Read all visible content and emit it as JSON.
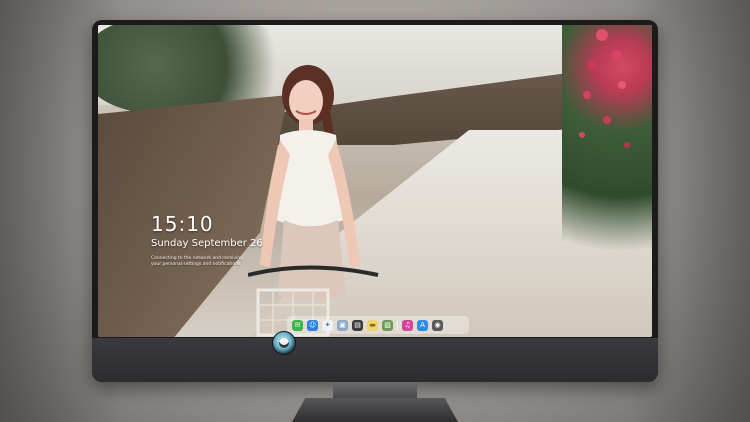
{
  "lock_screen": {
    "time": "15:10",
    "date": "Sunday September 26",
    "note_lines": [
      "Connecting to the network and receiving",
      "your personal settings and notifications"
    ]
  },
  "dock": {
    "items": [
      {
        "name": "messages",
        "icon": "speech-bubble-icon",
        "color": "#3bb44a",
        "glyph": "✉"
      },
      {
        "name": "finder",
        "icon": "finder-face-icon",
        "color": "#2a7fe0",
        "glyph": "☺"
      },
      {
        "name": "safari",
        "icon": "compass-icon",
        "color": "#f1f1f1",
        "glyph": "✦"
      },
      {
        "name": "preview",
        "icon": "photo-icon",
        "color": "#8aa8c8",
        "glyph": "▣"
      },
      {
        "name": "movie",
        "icon": "clapboard-icon",
        "color": "#3b3b3b",
        "glyph": "▤"
      },
      {
        "name": "notes",
        "icon": "note-pad-icon",
        "color": "#f3d36b",
        "glyph": "▬"
      },
      {
        "name": "photos",
        "icon": "image-icon",
        "color": "#6a9a56",
        "glyph": "▧"
      },
      {
        "name": "music",
        "icon": "music-note-icon",
        "color": "#d1459b",
        "glyph": "♫"
      },
      {
        "name": "app-store",
        "icon": "app-store-icon",
        "color": "#2d8de5",
        "glyph": "A"
      },
      {
        "name": "camera",
        "icon": "camera-icon",
        "color": "#5a5a5a",
        "glyph": "◉"
      }
    ]
  },
  "colors": {
    "bezel": "#1b1b1c",
    "chin": "#2c2c2e",
    "dock_bg": "rgba(255,255,255,0.35)"
  }
}
